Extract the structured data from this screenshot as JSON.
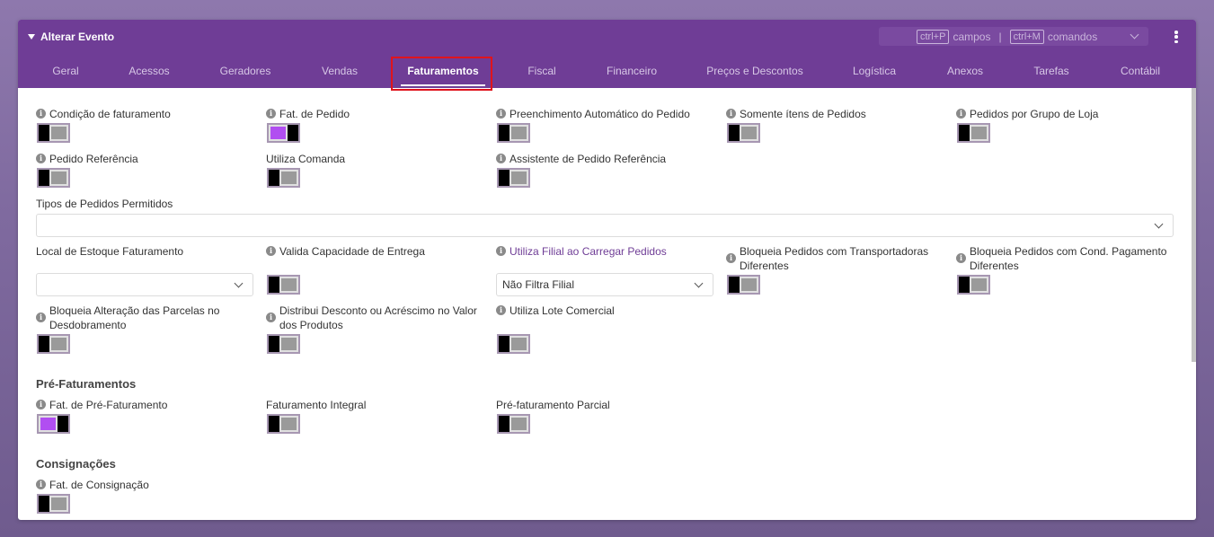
{
  "header": {
    "title": "Alterar Evento",
    "shortcut_fields_key": "ctrl+P",
    "shortcut_fields_label": "campos",
    "shortcut_sep": "|",
    "shortcut_commands_key": "ctrl+M",
    "shortcut_commands_label": "comandos"
  },
  "tabs": [
    {
      "label": "Geral"
    },
    {
      "label": "Acessos"
    },
    {
      "label": "Geradores"
    },
    {
      "label": "Vendas"
    },
    {
      "label": "Faturamentos"
    },
    {
      "label": "Fiscal"
    },
    {
      "label": "Financeiro"
    },
    {
      "label": "Preços e Descontos"
    },
    {
      "label": "Logística"
    },
    {
      "label": "Anexos"
    },
    {
      "label": "Tarefas"
    },
    {
      "label": "Contábil"
    }
  ],
  "fields": {
    "condicao_faturamento": {
      "label": "Condição de faturamento",
      "on": false
    },
    "fat_pedido": {
      "label": "Fat. de Pedido",
      "on": true
    },
    "preenchimento_auto": {
      "label": "Preenchimento Automático do Pedido",
      "on": false
    },
    "somente_itens": {
      "label": "Somente ítens de Pedidos",
      "on": false
    },
    "pedidos_grupo_loja": {
      "label": "Pedidos por Grupo de Loja",
      "on": false
    },
    "pedido_referencia": {
      "label": "Pedido Referência",
      "on": false
    },
    "utiliza_comanda": {
      "label": "Utiliza Comanda",
      "on": false
    },
    "assistente_pedido_ref": {
      "label": "Assistente de Pedido Referência",
      "on": false
    },
    "tipos_pedidos": {
      "label": "Tipos de Pedidos Permitidos",
      "value": ""
    },
    "local_estoque": {
      "label": "Local de Estoque Faturamento",
      "value": ""
    },
    "valida_capacidade": {
      "label": "Valida Capacidade de Entrega",
      "on": false
    },
    "utiliza_filial": {
      "label": "Utiliza Filial ao Carregar Pedidos",
      "value": "Não Filtra Filial"
    },
    "bloqueia_transportadoras": {
      "label": "Bloqueia Pedidos com Transportadoras Diferentes",
      "on": false
    },
    "bloqueia_cond_pagamento": {
      "label": "Bloqueia Pedidos com Cond. Pagamento Diferentes",
      "on": false
    },
    "bloqueia_parcelas": {
      "label": "Bloqueia Alteração das Parcelas no Desdobramento",
      "on": false
    },
    "distribui_desconto": {
      "label": "Distribui Desconto ou Acréscimo no Valor dos Produtos",
      "on": false
    },
    "utiliza_lote": {
      "label": "Utiliza Lote Comercial",
      "on": false
    }
  },
  "pre_faturamentos": {
    "title": "Pré-Faturamentos",
    "fat_pre": {
      "label": "Fat. de Pré-Faturamento",
      "on": true
    },
    "integral": {
      "label": "Faturamento Integral",
      "on": false
    },
    "parcial": {
      "label": "Pré-faturamento Parcial",
      "on": false
    }
  },
  "consignacoes": {
    "title": "Consignações",
    "fat_consignacao": {
      "label": "Fat. de Consignação",
      "on": false
    }
  },
  "colors": {
    "header": "#6f3d96",
    "toggle_on": "#b14ef1",
    "highlight": "#e0141c"
  }
}
